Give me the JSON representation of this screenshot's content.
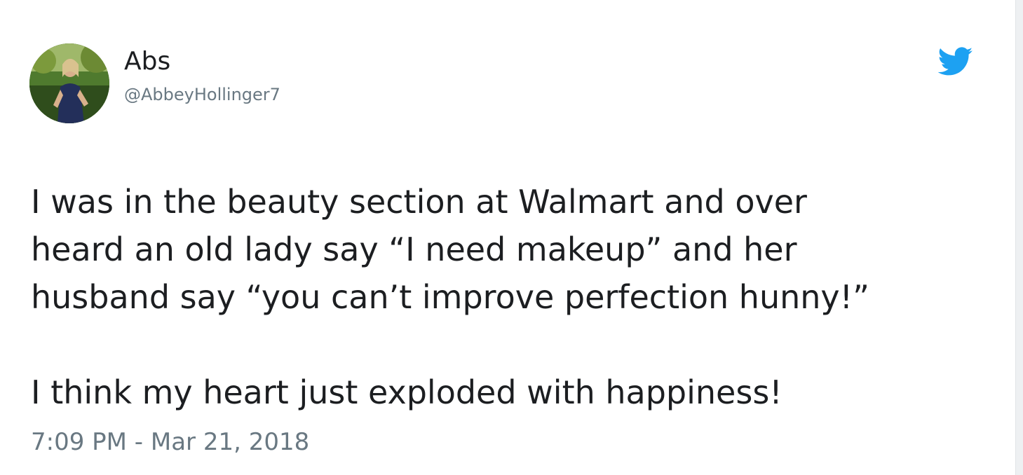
{
  "author": {
    "display_name": "Abs",
    "handle": "@AbbeyHollinger7"
  },
  "tweet": {
    "paragraphs": [
      "I was in the beauty section at Walmart and over\nheard an old lady say “I need makeup” and her\nhusband say “you can’t improve perfection hunny!”",
      "I think my heart just exploded with happiness!"
    ],
    "timestamp": "7:09 PM - Mar 21, 2018"
  },
  "icons": {
    "logo": "twitter-bird-icon",
    "avatar": "profile-photo"
  },
  "colors": {
    "brand": "#1da1f2",
    "text": "#1c1e21",
    "muted": "#697882"
  }
}
